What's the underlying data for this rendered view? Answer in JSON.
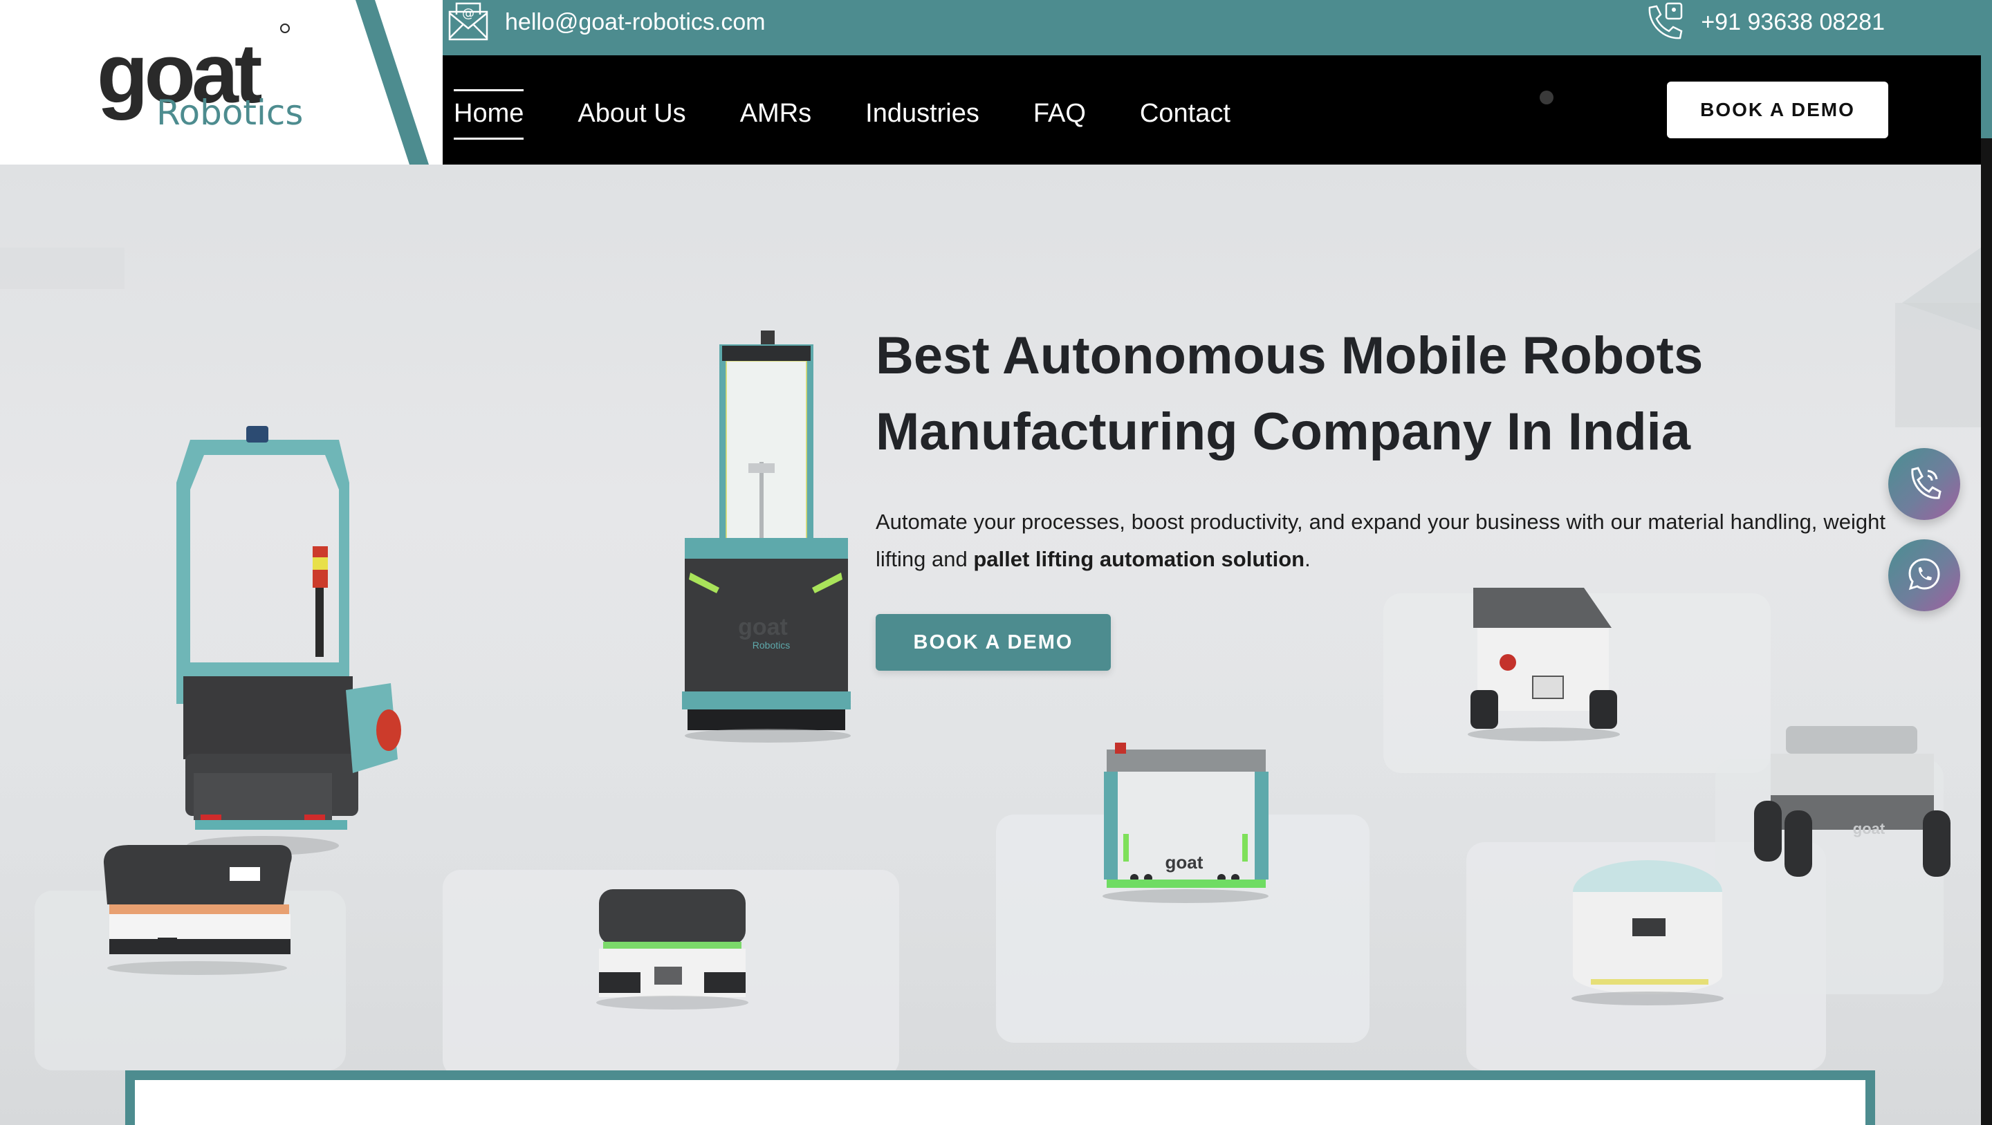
{
  "brand": {
    "logo_word": "goat",
    "logo_sub": "Robotics",
    "colors": {
      "teal": "#4d8c8f",
      "dark": "#000000",
      "text": "#222428"
    }
  },
  "topbar": {
    "email_icon": "envelope-at-icon",
    "email": "hello@goat-robotics.com",
    "phone_icon": "phone-icon",
    "phone": "+91 93638 08281"
  },
  "nav": {
    "items": [
      {
        "label": "Home",
        "active": true
      },
      {
        "label": "About Us",
        "active": false
      },
      {
        "label": "AMRs",
        "active": false
      },
      {
        "label": "Industries",
        "active": false
      },
      {
        "label": "FAQ",
        "active": false
      },
      {
        "label": "Contact",
        "active": false
      }
    ],
    "cta": "BOOK A DEMO"
  },
  "hero": {
    "title_line1": "Best Autonomous Mobile Robots",
    "title_line2": "Manufacturing Company In India",
    "description": "Automate your processes, boost productivity, and expand your business with our material handling, weight lifting and ",
    "description_bold": "pallet lifting automation solution",
    "description_end": ".",
    "cta": "BOOK A DEMO",
    "robot_brand_mark": "goat",
    "robot_brand_sub": "Robotics"
  },
  "floating": {
    "call_icon": "phone-icon",
    "whatsapp_icon": "whatsapp-icon"
  }
}
